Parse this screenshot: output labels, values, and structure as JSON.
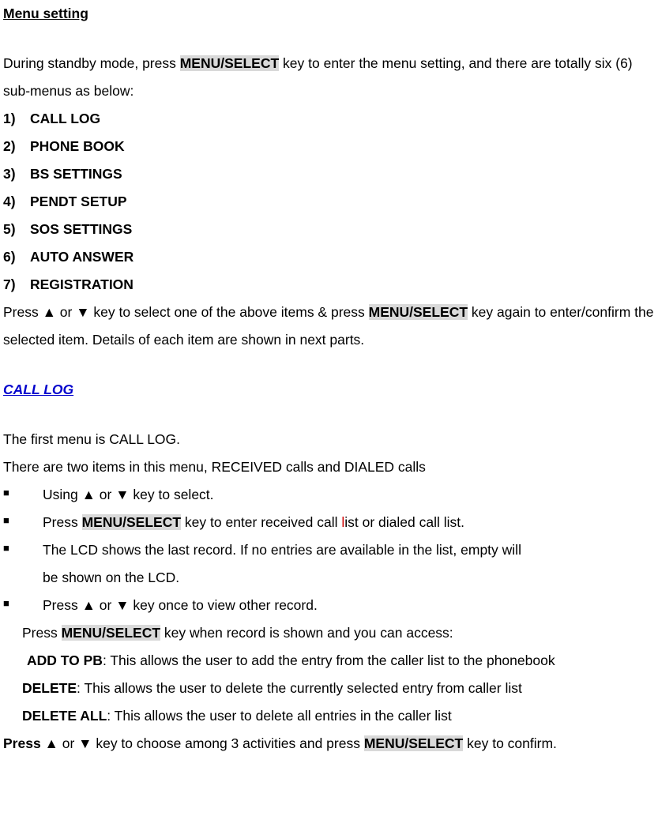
{
  "heading": "Menu setting",
  "intro_a": "During standby mode, press ",
  "intro_key": "MENU/SELECT",
  "intro_b": " key to enter the menu setting, and there are totally six (6) sub-menus as below:",
  "menus": [
    {
      "n": "1)",
      "t": "CALL LOG"
    },
    {
      "n": "2)",
      "t": "PHONE BOOK"
    },
    {
      "n": "3)",
      "t": "BS SETTINGS"
    },
    {
      "n": "4)",
      "t": "PENDT SETUP"
    },
    {
      "n": "5)",
      "t": "SOS SETTINGS"
    },
    {
      "n": "6)",
      "t": "AUTO ANSWER"
    },
    {
      "n": "7)",
      "t": "REGISTRATION"
    }
  ],
  "press_a": "Press ▲ or ▼ key to select one of the above items & press ",
  "press_key": "MENU/SELECT",
  "press_b": " key again to enter/confirm the selected item. Details of each item are shown in next parts.",
  "call_log_heading": "CALL LOG",
  "cl_first": "The first menu is CALL LOG.",
  "cl_two": "There are two items in this menu, RECEIVED calls and DIALED calls",
  "bul1": "Using ▲ or ▼ key to select.",
  "bul2a": "Press ",
  "bul2_key": "MENU/SELECT",
  "bul2b": " key to enter received call ",
  "bul2_l": "l",
  "bul2c": "ist or dialed call list.",
  "bul3a": "The LCD shows the last record. If no entries are available in the list, empty will",
  "bul3b": "be shown on the LCD.",
  "bul4": "Press ▲ or ▼ key once to view other record.",
  "rec_a": "Press ",
  "rec_key": "MENU/SELECT",
  "rec_b": " key when record is shown and you can access:",
  "add_pb_label": "ADD TO PB",
  "add_pb_text": ": This allows the user to add the entry from the caller list to the phonebook",
  "delete_label": "DELETE",
  "delete_text": ": This allows the user to delete the currently selected entry from caller list",
  "delete_all_label": "DELETE ALL",
  "delete_all_text": ": This allows the user to delete all entries in the caller list",
  "final_bold_a": "Press ",
  "final_mid": "▲ or ▼ key to choose among 3 activities and press ",
  "final_key": "MENU/SELECT",
  "final_b": " key to confirm.",
  "square": "■"
}
